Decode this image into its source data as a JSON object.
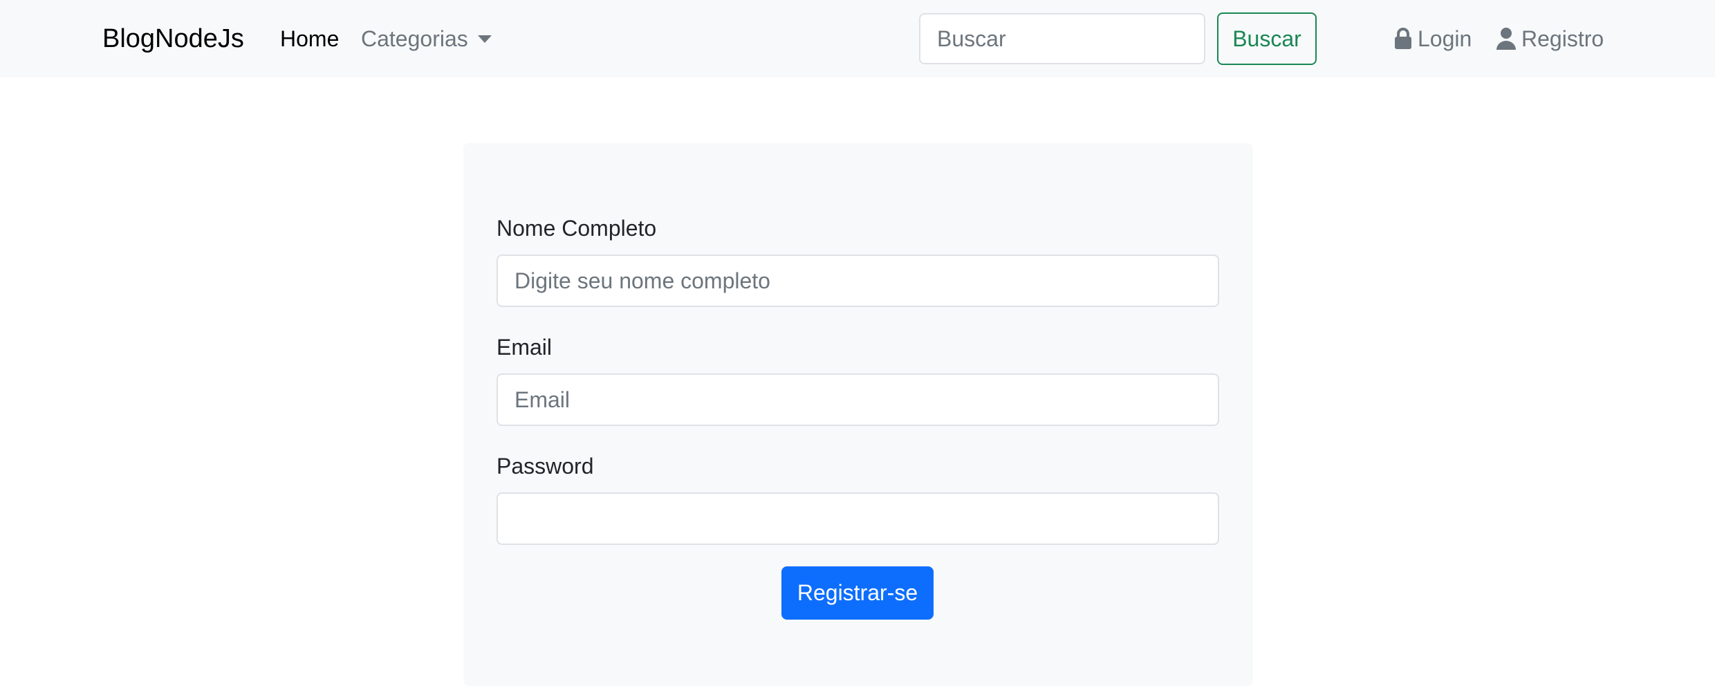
{
  "navbar": {
    "brand": "BlogNodeJs",
    "home": "Home",
    "categories": "Categorias",
    "search_placeholder": "Buscar",
    "search_button": "Buscar",
    "login": "Login",
    "register": "Registro"
  },
  "form": {
    "name_label": "Nome Completo",
    "name_placeholder": "Digite seu nome completo",
    "email_label": "Email",
    "email_placeholder": "Email",
    "password_label": "Password",
    "password_value": "",
    "submit": "Registrar-se"
  },
  "icons": {
    "login": "lock-icon",
    "register": "user-icon",
    "categories": "caret-down-icon"
  },
  "colors": {
    "navbar_bg": "#f8f9fa",
    "success": "#198754",
    "primary": "#0d6efd",
    "muted": "#6c757d"
  }
}
